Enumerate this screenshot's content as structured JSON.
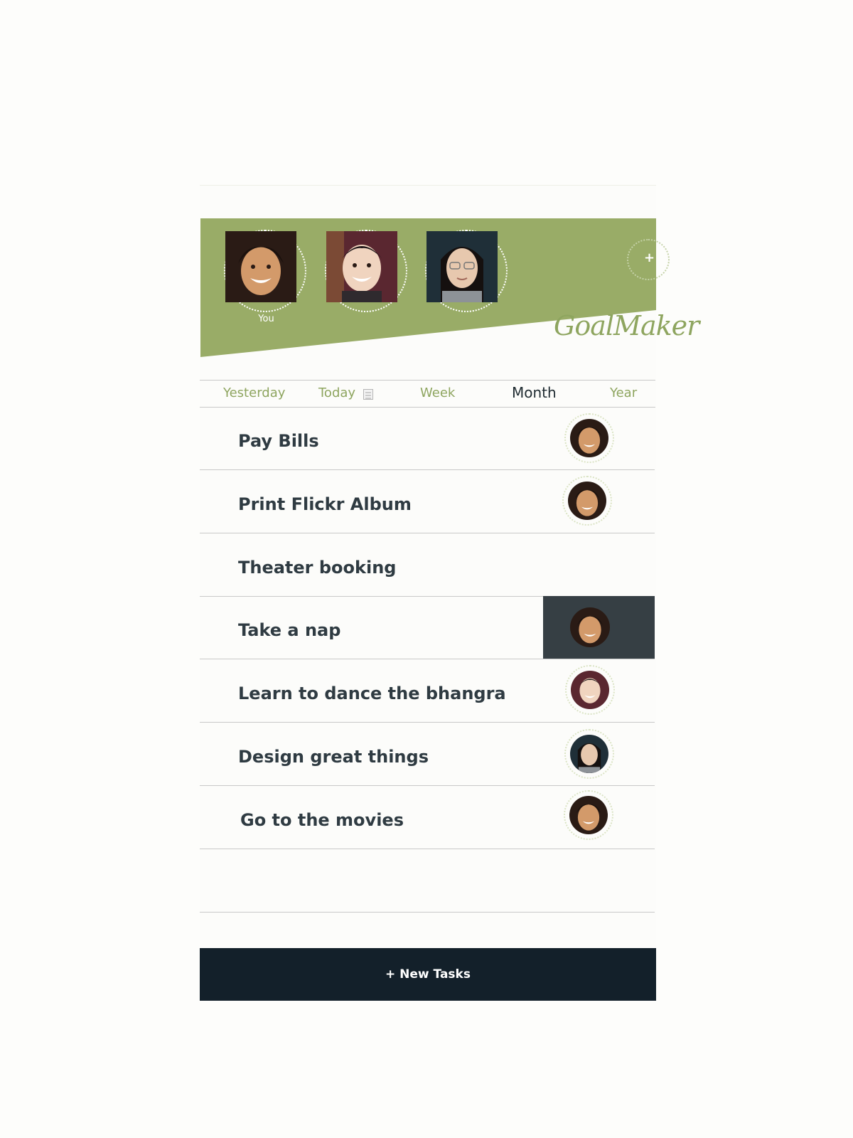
{
  "app": {
    "logo": "GoalMaker",
    "colors": {
      "brand_green": "#99ac67",
      "text_dark": "#2f3b42",
      "footer_dark": "#13202a"
    }
  },
  "header": {
    "members": [
      {
        "name": "You",
        "face": "woman-smile"
      },
      {
        "name": "",
        "face": "man-smile"
      },
      {
        "name": "",
        "face": "woman-glasses"
      }
    ],
    "add_icon": "+"
  },
  "tabs": [
    {
      "label": "Yesterday",
      "active": false
    },
    {
      "label": "Today",
      "active": false,
      "icon": "calendar-icon"
    },
    {
      "label": "Week",
      "active": false
    },
    {
      "label": "Month",
      "active": true
    },
    {
      "label": "Year",
      "active": false
    }
  ],
  "tasks": [
    {
      "title": "Pay Bills",
      "assignee": "woman-smile",
      "selected": false
    },
    {
      "title": "Print Flickr Album",
      "assignee": "woman-smile",
      "selected": false
    },
    {
      "title": "Theater booking",
      "assignee": "",
      "selected": false
    },
    {
      "title": "Take a nap",
      "assignee": "woman-smile",
      "selected": true
    },
    {
      "title": "Learn to dance the bhangra",
      "assignee": "man-smile",
      "selected": false
    },
    {
      "title": "Design great things",
      "assignee": "woman-glasses",
      "selected": false
    },
    {
      "title": "Go to the movies",
      "assignee": "woman-smile",
      "selected": false
    }
  ],
  "footer": {
    "new_task_label": "+ New Tasks"
  }
}
